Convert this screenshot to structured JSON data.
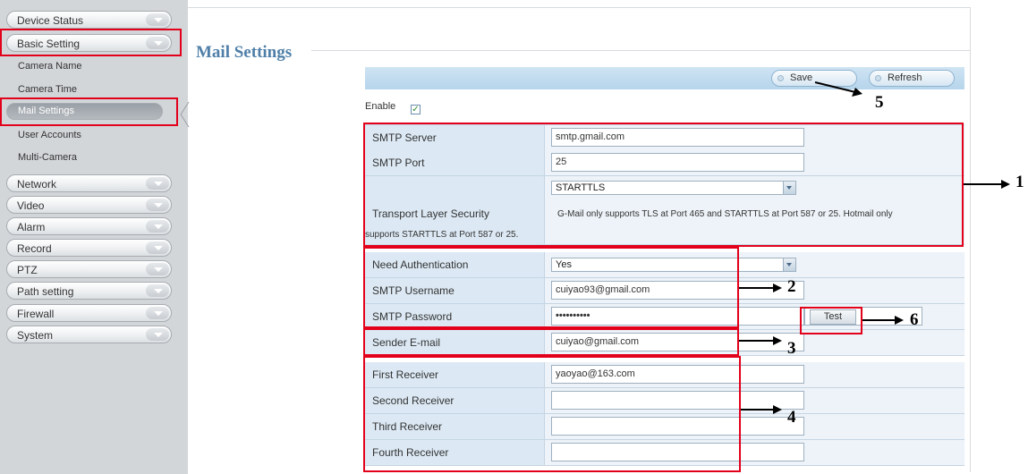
{
  "sidebar": {
    "top_items": [
      {
        "label": "Device Status"
      },
      {
        "label": "Basic Setting"
      }
    ],
    "sub_items": [
      {
        "label": "Camera Name"
      },
      {
        "label": "Camera Time"
      },
      {
        "label": "Mail Settings"
      },
      {
        "label": "User Accounts"
      },
      {
        "label": "Multi-Camera"
      }
    ],
    "bottom_items": [
      {
        "label": "Network"
      },
      {
        "label": "Video"
      },
      {
        "label": "Alarm"
      },
      {
        "label": "Record"
      },
      {
        "label": "PTZ"
      },
      {
        "label": "Path setting"
      },
      {
        "label": "Firewall"
      },
      {
        "label": "System"
      }
    ]
  },
  "main": {
    "title": "Mail Settings",
    "toolbar": {
      "save_label": "Save",
      "refresh_label": "Refresh"
    },
    "enable": {
      "label": "Enable",
      "checked": true
    },
    "fields": {
      "smtp_server": {
        "label": "SMTP Server",
        "value": "smtp.gmail.com"
      },
      "smtp_port": {
        "label": "SMTP Port",
        "value": "25"
      },
      "tls": {
        "label": "Transport Layer Security",
        "value": "STARTTLS",
        "note_line1": "G-Mail only supports TLS at Port 465 and STARTTLS at Port 587 or 25. Hotmail only",
        "note_line2": "supports STARTTLS at Port 587 or 25."
      },
      "need_auth": {
        "label": "Need Authentication",
        "value": "Yes"
      },
      "username": {
        "label": "SMTP Username",
        "value": "cuiyao93@gmail.com"
      },
      "password": {
        "label": "SMTP Password",
        "value": "••••••••••"
      },
      "test_label": "Test",
      "sender": {
        "label": "Sender E-mail",
        "value": "cuiyao@gmail.com"
      },
      "first_receiver": {
        "label": "First Receiver",
        "value": "yaoyao@163.com"
      },
      "second_receiver": {
        "label": "Second Receiver",
        "value": ""
      },
      "third_receiver": {
        "label": "Third Receiver",
        "value": ""
      },
      "fourth_receiver": {
        "label": "Fourth Receiver",
        "value": ""
      }
    }
  },
  "annotations": {
    "n1": "1",
    "n2": "2",
    "n3": "3",
    "n4": "4",
    "n5": "5",
    "n6": "6",
    "color": "#e3001b"
  }
}
